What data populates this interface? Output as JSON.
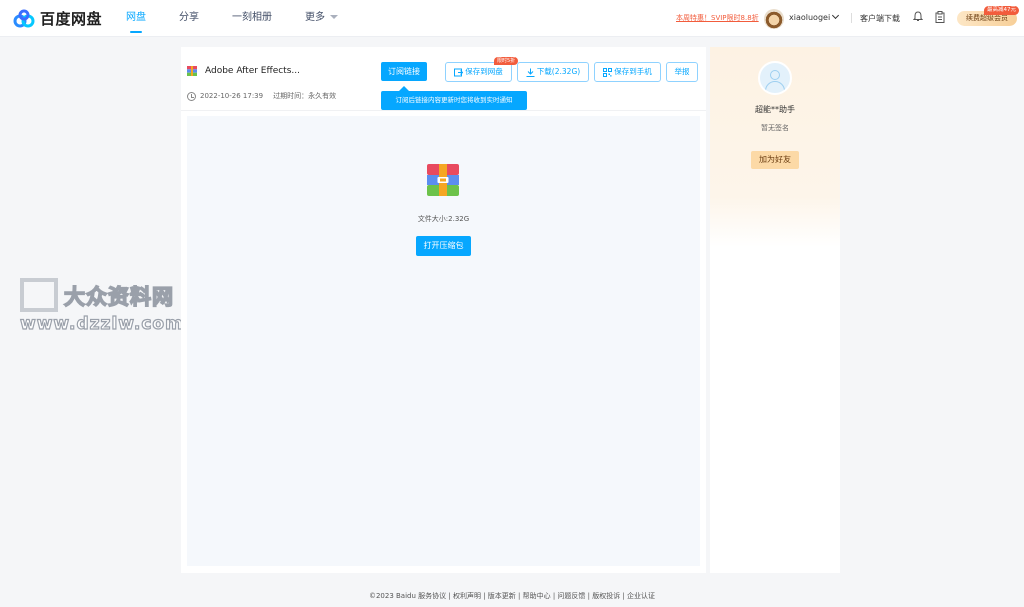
{
  "header": {
    "logo_text": "百度网盘",
    "nav": [
      {
        "label": "网盘"
      },
      {
        "label": "分享"
      },
      {
        "label": "一刻相册"
      },
      {
        "label": "更多"
      }
    ],
    "promo_text": "本周特惠！SVIP限时8.8折",
    "username": "xiaoluogei",
    "client_download": "客户端下载",
    "svip_button": "续费超级会员",
    "svip_tag": "最高减47元"
  },
  "share": {
    "file_name": "Adobe After Effects...",
    "date": "2022-10-26 17:39",
    "expire_label": "过期时间：永久有效",
    "subscribe_button": "订阅链接",
    "subscribe_tip": "订阅后链接内容更新时您将收到实时通知",
    "save_button": "保存到网盘",
    "limited_tag": "限时5折",
    "download_button": "下载(2.32G)",
    "save_phone_button": "保存到手机",
    "report_button": "举报",
    "file_size_text": "文件大小:2.32G",
    "open_button": "打开压缩包"
  },
  "sharer": {
    "name": "超能**助手",
    "signature": "暂无签名",
    "add_friend_button": "加为好友"
  },
  "watermark": {
    "cn": "大众资料网",
    "url": "www.dzzlw.com"
  },
  "footer": {
    "copyright": "©2023 Baidu",
    "links": [
      "服务协议",
      "权利声明",
      "版本更新",
      "帮助中心",
      "问题反馈",
      "版权投诉",
      "企业认证"
    ]
  },
  "colors": {
    "accent": "#06a7ff",
    "promo": "#f25c3c"
  }
}
